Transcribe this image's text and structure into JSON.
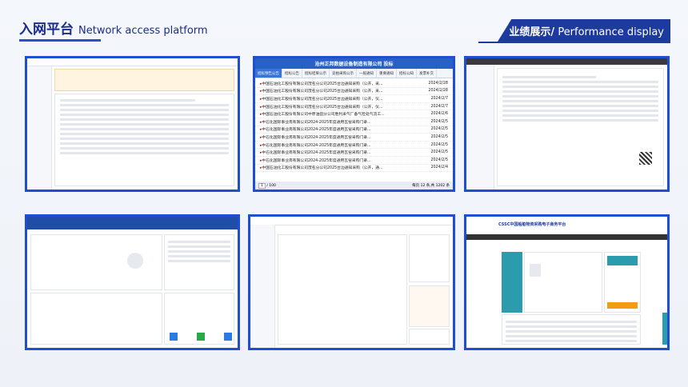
{
  "header": {
    "title_cn": "入网平台",
    "title_en": "Network access platform",
    "section_cn": "业绩展示/",
    "section_en": "Performance display"
  },
  "thumb2": {
    "title": "沧州正邦数据设备制造有限公司 投标",
    "tabs": [
      "招标预告公告",
      "招标公告",
      "招标结果公示",
      "竞拍采购公示",
      "一般通知",
      "重要通知",
      "招标公知",
      "发票补交"
    ],
    "rows": [
      {
        "text": "中国石油化工股份有限公司茂名分公司2025台边通知采购（公开，采...",
        "date": "2024/2/28"
      },
      {
        "text": "中国石油化工股份有限公司茂名分公司2025台边通知采购（公开，采...",
        "date": "2024/2/28"
      },
      {
        "text": "中国石油化工股份有限公司茂名分公司2025台边通知采购（公开，仪...",
        "date": "2024/2/7"
      },
      {
        "text": "中国石油化工股份有限公司茂名分公司2025台边通知采购（公开，仪...",
        "date": "2024/2/7"
      },
      {
        "text": "中国石油化工股份有限公司中原油田分公司胜利采气厂备气检处气流工...",
        "date": "2024/2/6"
      },
      {
        "text": "中石化国际事业南有限公司2024-2025年度通用瓦窑采购门录...",
        "date": "2024/2/5"
      },
      {
        "text": "中石化国际事业南有限公司2024-2025年度通用瓦窑采购门录...",
        "date": "2024/2/5"
      },
      {
        "text": "中石化国际事业南有限公司2024-2025年度通用瓦窑采购门录...",
        "date": "2024/2/5"
      },
      {
        "text": "中石化国际事业南有限公司2024-2025年度通用瓦窑采购门录...",
        "date": "2024/2/5"
      },
      {
        "text": "中石化国际事业南有限公司2024-2025年度通用瓦窑采购门录...",
        "date": "2024/2/5"
      },
      {
        "text": "中石化国际事业南有限公司2024-2025年度通用瓦窑采购门录...",
        "date": "2024/2/5"
      },
      {
        "text": "中国石油化工股份有限公司茂名分公司2025台边通知采购（公开，通...",
        "date": "2024/2/4"
      }
    ],
    "page_current": "1",
    "page_total": "/ 100",
    "footer_count": "每页 12 条,共 1202 条"
  },
  "thumb6": {
    "brand": "CSSC中国船舶物资采购电子商务平台"
  },
  "colors": {
    "brand": "#1f4ed1",
    "header_blue": "#1d3a9e"
  }
}
